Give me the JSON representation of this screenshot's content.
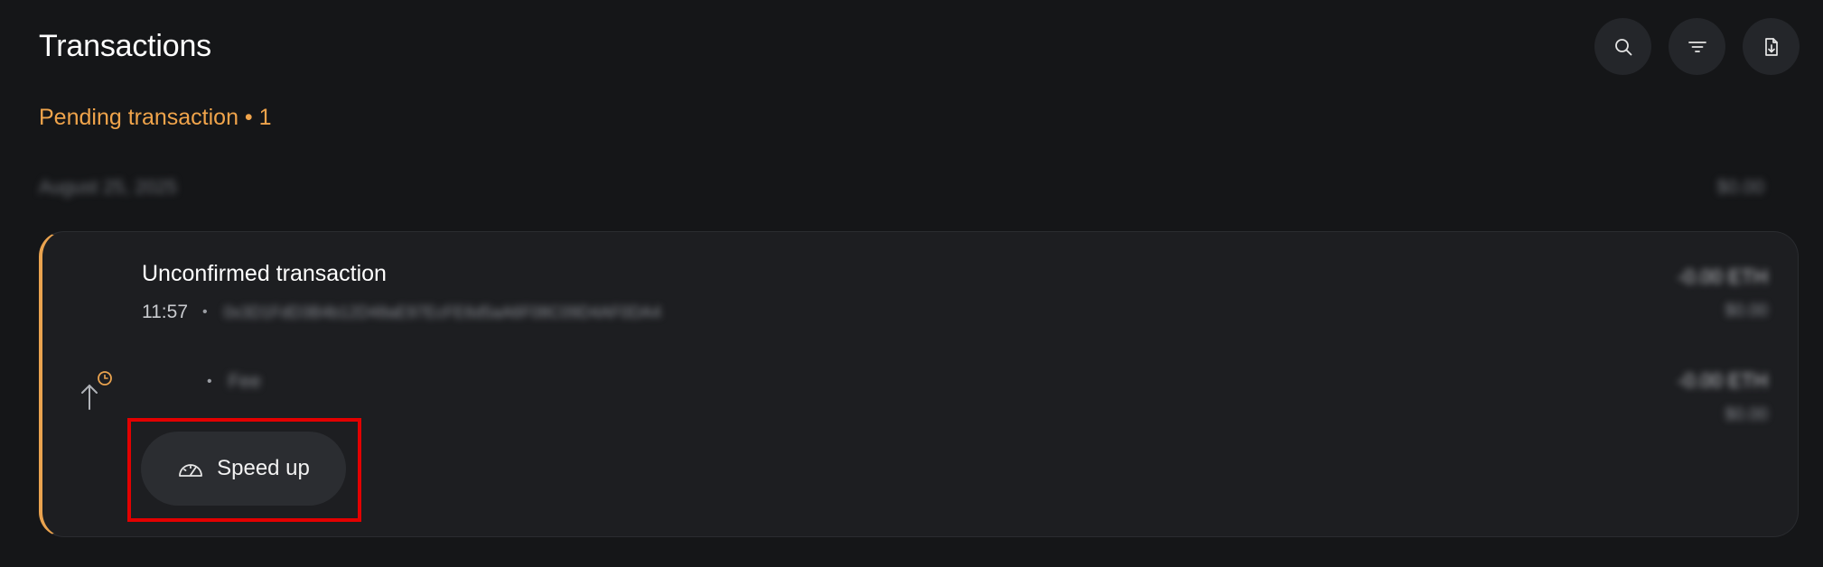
{
  "header": {
    "title": "Transactions",
    "actions": [
      {
        "icon": "search-icon"
      },
      {
        "icon": "filter-icon"
      },
      {
        "icon": "export-icon"
      }
    ]
  },
  "pending": {
    "label": "Pending transaction • 1"
  },
  "group": {
    "date": "August 25, 2025",
    "total": "$0.00"
  },
  "transaction": {
    "title": "Unconfirmed transaction",
    "time": "11:57",
    "hash": "0x3D1FdD3B4b12D48aE97EcFE6d5aA6F08C09D4AF0DA4",
    "amount": "-0.00 ETH",
    "amount_fiat": "$0.00",
    "fee_label": "Fee",
    "fee_amount": "-0.00 ETH",
    "fee_fiat": "$0.00",
    "status_icon": "pending-send-icon"
  },
  "speed_up": {
    "label": "Speed up",
    "icon": "speedometer-icon"
  },
  "colors": {
    "accent": "#eaa34f",
    "background": "#151618",
    "card": "#1d1e21",
    "highlight": "#e30000"
  }
}
